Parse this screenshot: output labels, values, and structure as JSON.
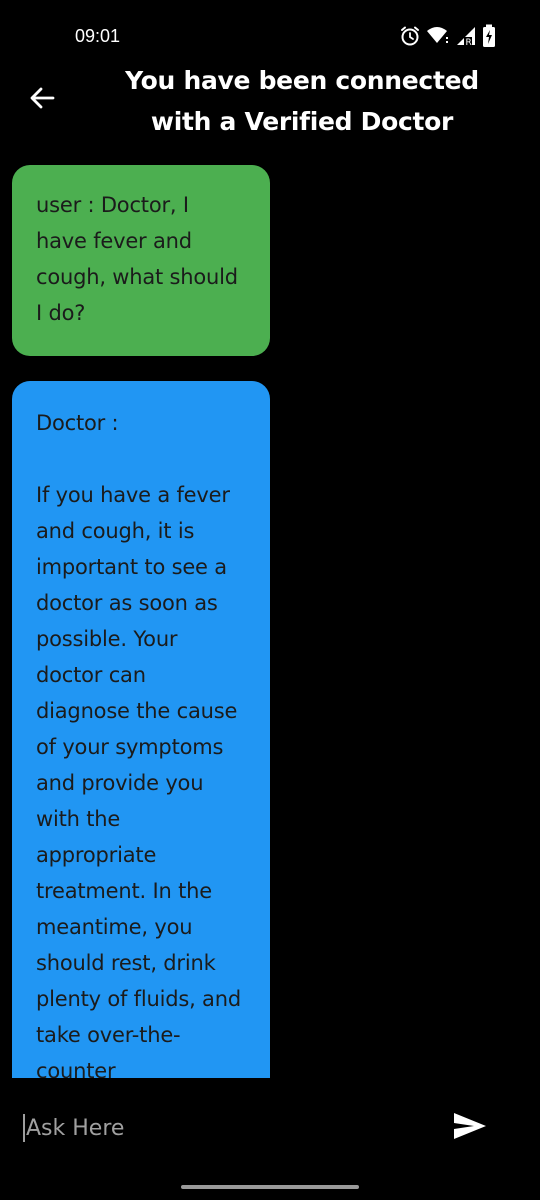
{
  "status_bar": {
    "time": "09:01",
    "icons": [
      "alarm-icon",
      "wifi-icon",
      "signal-icon",
      "battery-charging-icon"
    ],
    "signal_badge": "R"
  },
  "header": {
    "back_icon": "arrow-left-icon",
    "title": "You have been connected with a Verified Doctor"
  },
  "messages": [
    {
      "role": "user",
      "text": "user : Doctor, I have fever and cough, what should I do?",
      "color": "#4caf50"
    },
    {
      "role": "doctor",
      "label": "Doctor :",
      "text": "If you have a fever and cough, it is important to see a doctor as soon as possible. Your doctor can diagnose the cause of your symptoms and provide you with the appropriate treatment. In the meantime, you should rest, drink plenty of fluids, and take over-the-counter",
      "color": "#2196f3"
    }
  ],
  "input": {
    "placeholder": "Ask Here",
    "value": "",
    "send_icon": "send-icon"
  },
  "colors": {
    "background": "#000000",
    "user_bubble": "#4caf50",
    "doctor_bubble": "#2196f3"
  }
}
